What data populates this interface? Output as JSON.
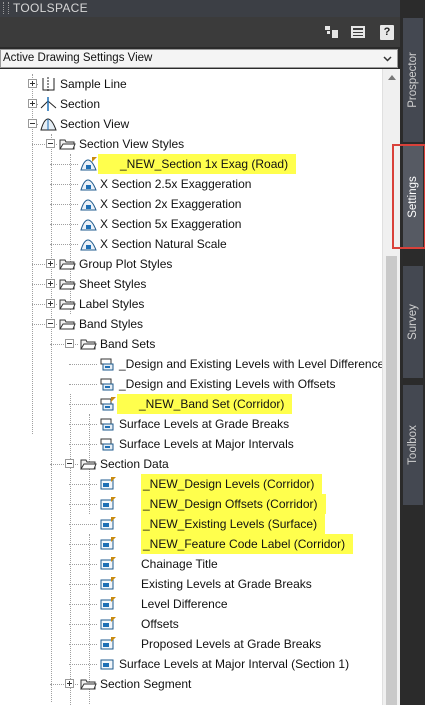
{
  "palette": {
    "title": "TOOLSPACE"
  },
  "toolbar": {
    "help_label": "?"
  },
  "view_select": {
    "value": "Active Drawing Settings View"
  },
  "tabs": [
    {
      "label": "Prospector",
      "active": false
    },
    {
      "label": "Settings",
      "active": true
    },
    {
      "label": "Survey",
      "active": false
    },
    {
      "label": "Toolbox",
      "active": false
    }
  ],
  "tree": [
    {
      "label": "Sample Line",
      "depth": 1,
      "expander": "plus",
      "icon": "sample-line-icon",
      "highlight": false
    },
    {
      "label": "Section",
      "depth": 1,
      "expander": "plus",
      "icon": "section-icon",
      "highlight": false
    },
    {
      "label": "Section View",
      "depth": 1,
      "expander": "minus",
      "icon": "section-view-icon",
      "highlight": false
    },
    {
      "label": "Section View Styles",
      "depth": 2,
      "expander": "minus",
      "icon": "folder-open-icon",
      "highlight": false
    },
    {
      "label": "_NEW_Section 1x Exag (Road)",
      "depth": 3,
      "expander": "",
      "icon": "section-view-style-icon",
      "highlight": true,
      "flag": true
    },
    {
      "label": "X Section 2.5x Exaggeration",
      "depth": 3,
      "expander": "",
      "icon": "section-view-style-icon",
      "highlight": false
    },
    {
      "label": "X Section 2x Exaggeration",
      "depth": 3,
      "expander": "",
      "icon": "section-view-style-icon",
      "highlight": false
    },
    {
      "label": "X Section 5x Exaggeration",
      "depth": 3,
      "expander": "",
      "icon": "section-view-style-icon",
      "highlight": false
    },
    {
      "label": "X Section Natural Scale",
      "depth": 3,
      "expander": "",
      "icon": "section-view-style-icon",
      "highlight": false
    },
    {
      "label": "Group Plot Styles",
      "depth": 2,
      "expander": "plus",
      "icon": "folder-open-icon",
      "highlight": false
    },
    {
      "label": "Sheet Styles",
      "depth": 2,
      "expander": "plus",
      "icon": "folder-open-icon",
      "highlight": false
    },
    {
      "label": "Label Styles",
      "depth": 2,
      "expander": "plus",
      "icon": "folder-open-icon",
      "highlight": false
    },
    {
      "label": "Band Styles",
      "depth": 2,
      "expander": "minus",
      "icon": "folder-open-icon",
      "highlight": false
    },
    {
      "label": "Band Sets",
      "depth": 3,
      "expander": "minus",
      "icon": "folder-open-icon",
      "highlight": false
    },
    {
      "label": "_Design and Existing Levels with Level Difference",
      "depth": 4,
      "expander": "",
      "icon": "band-set-icon",
      "highlight": false
    },
    {
      "label": "_Design and Existing Levels with Offsets",
      "depth": 4,
      "expander": "",
      "icon": "band-set-icon",
      "highlight": false
    },
    {
      "label": "_NEW_Band Set (Corridor)",
      "depth": 4,
      "expander": "",
      "icon": "band-set-icon",
      "highlight": true,
      "flag": true
    },
    {
      "label": "Surface Levels at Grade Breaks",
      "depth": 4,
      "expander": "",
      "icon": "band-set-icon",
      "highlight": false
    },
    {
      "label": "Surface Levels at Major Intervals",
      "depth": 4,
      "expander": "",
      "icon": "band-set-icon",
      "highlight": false
    },
    {
      "label": "Section Data",
      "depth": 3,
      "expander": "minus",
      "icon": "folder-open-icon",
      "highlight": false
    },
    {
      "label": "_NEW_Design Levels (Corridor)",
      "depth": 4,
      "expander": "",
      "icon": "band-style-icon",
      "highlight": true,
      "flag": true,
      "indent": true
    },
    {
      "label": "_NEW_Design Offsets (Corridor)",
      "depth": 4,
      "expander": "",
      "icon": "band-style-icon",
      "highlight": true,
      "flag": true,
      "indent": true
    },
    {
      "label": "_NEW_Existing Levels (Surface)",
      "depth": 4,
      "expander": "",
      "icon": "band-style-icon",
      "highlight": true,
      "flag": true,
      "indent": true
    },
    {
      "label": "_NEW_Feature Code Label (Corridor)",
      "depth": 4,
      "expander": "",
      "icon": "band-style-icon",
      "highlight": true,
      "flag": true,
      "indent": true
    },
    {
      "label": "Chainage Title",
      "depth": 4,
      "expander": "",
      "icon": "band-style-icon",
      "highlight": false,
      "flag": true,
      "indent": true
    },
    {
      "label": "Existing Levels at Grade Breaks",
      "depth": 4,
      "expander": "",
      "icon": "band-style-icon",
      "highlight": false,
      "flag": true,
      "indent": true
    },
    {
      "label": "Level Difference",
      "depth": 4,
      "expander": "",
      "icon": "band-style-icon",
      "highlight": false,
      "flag": true,
      "indent": true
    },
    {
      "label": "Offsets",
      "depth": 4,
      "expander": "",
      "icon": "band-style-icon",
      "highlight": false,
      "flag": true,
      "indent": true
    },
    {
      "label": "Proposed Levels at Grade Breaks",
      "depth": 4,
      "expander": "",
      "icon": "band-style-icon",
      "highlight": false,
      "flag": true,
      "indent": true
    },
    {
      "label": "Surface Levels at Major Interval (Section 1)",
      "depth": 4,
      "expander": "",
      "icon": "band-style-icon",
      "highlight": false
    },
    {
      "label": "Section Segment",
      "depth": 3,
      "expander": "plus",
      "icon": "folder-open-icon",
      "highlight": false
    }
  ]
}
